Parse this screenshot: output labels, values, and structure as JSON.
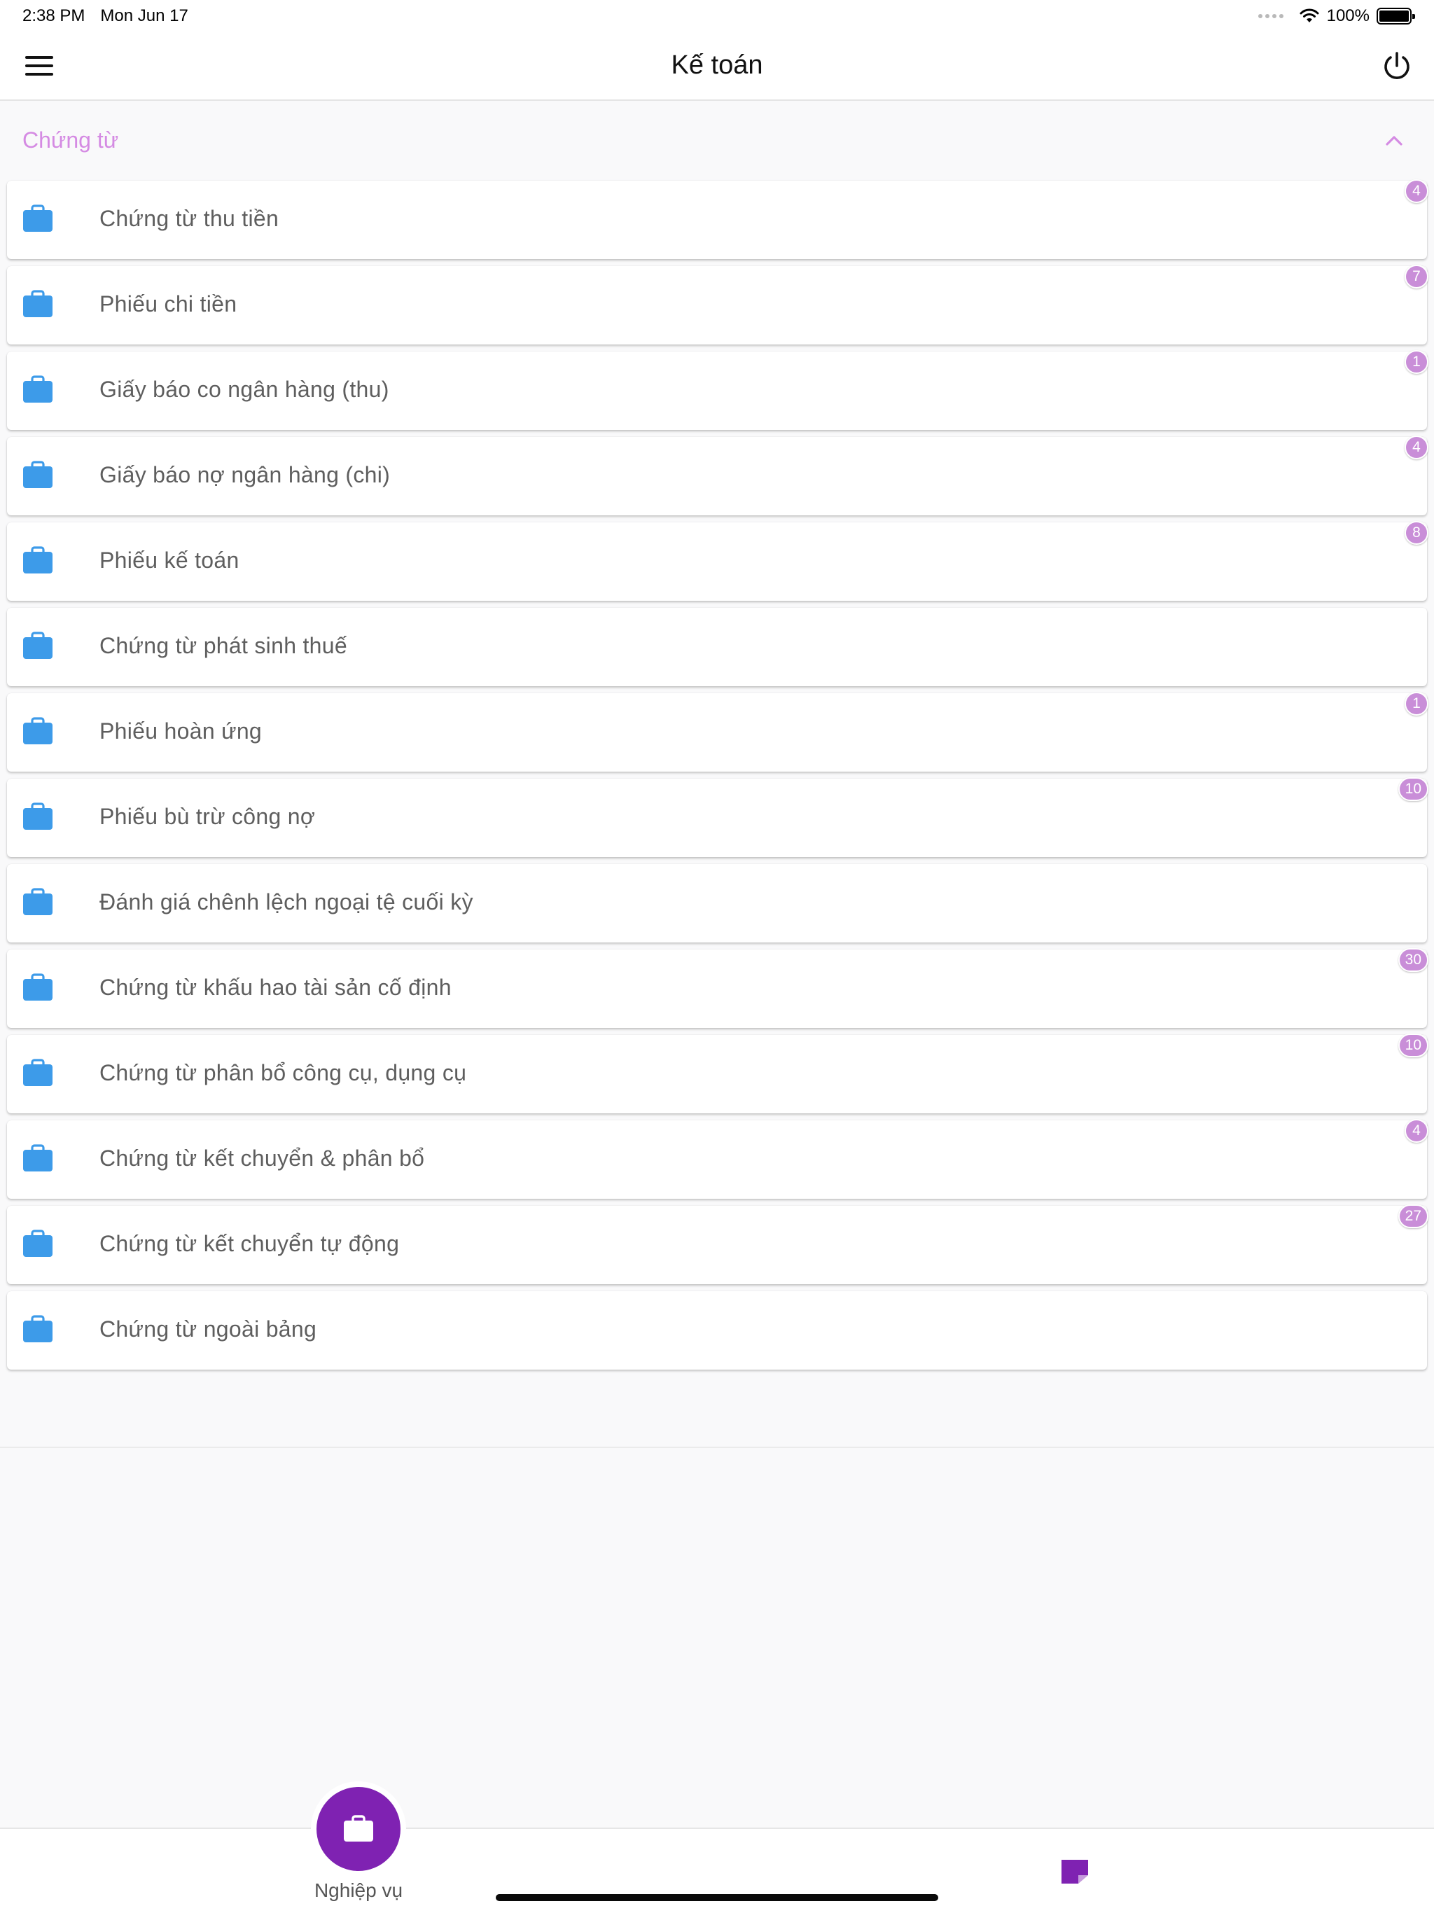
{
  "status_bar": {
    "time": "2:38 PM",
    "date": "Mon Jun 17",
    "battery": "100%"
  },
  "header": {
    "title": "Kế toán"
  },
  "section": {
    "title": "Chứng từ"
  },
  "items": [
    {
      "label": "Chứng từ thu tiền",
      "badge": "4"
    },
    {
      "label": "Phiếu chi tiền",
      "badge": "7"
    },
    {
      "label": "Giấy báo co ngân hàng (thu)",
      "badge": "1"
    },
    {
      "label": "Giấy báo nợ ngân hàng (chi)",
      "badge": "4"
    },
    {
      "label": "Phiếu kế toán",
      "badge": "8"
    },
    {
      "label": "Chứng từ phát sinh thuế",
      "badge": ""
    },
    {
      "label": "Phiếu hoàn ứng",
      "badge": "1"
    },
    {
      "label": "Phiếu bù trừ công nợ",
      "badge": "10"
    },
    {
      "label": "Đánh giá chênh lệch ngoại tệ cuối kỳ",
      "badge": ""
    },
    {
      "label": "Chứng từ khấu hao tài sản cố định",
      "badge": "30"
    },
    {
      "label": "Chứng từ phân bổ công cụ, dụng cụ",
      "badge": "10"
    },
    {
      "label": "Chứng từ kết chuyển & phân bổ",
      "badge": "4"
    },
    {
      "label": "Chứng từ kết chuyển tự động",
      "badge": "27"
    },
    {
      "label": "Chứng từ ngoài bảng",
      "badge": ""
    }
  ],
  "tab_bar": {
    "active_tab_label": "Nghiệp vụ"
  },
  "colors": {
    "accent_purple": "#7f22b2",
    "section_title": "#d58be3",
    "badge": "#c98ed8",
    "item_icon_blue": "#3d9be9"
  },
  "icons": {
    "menu": "hamburger-menu-icon",
    "power": "power-icon",
    "collapse": "chevron-up-icon",
    "item": "briefcase-icon",
    "tab_active": "briefcase-icon",
    "tab_other": "document-icon"
  }
}
